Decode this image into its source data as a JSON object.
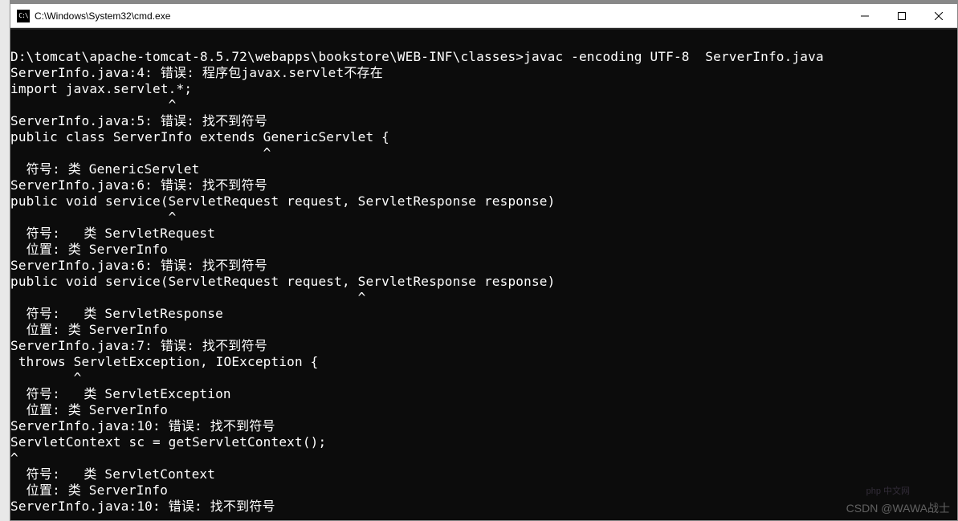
{
  "window": {
    "title": "C:\\Windows\\System32\\cmd.exe",
    "icon_label": "C:\\"
  },
  "terminal": {
    "prompt_path": "D:\\tomcat\\apache-tomcat-8.5.72\\webapps\\bookstore\\WEB-INF\\classes>",
    "command": "javac -encoding UTF-8  ServerInfo.java",
    "output_lines": [
      "",
      "D:\\tomcat\\apache-tomcat-8.5.72\\webapps\\bookstore\\WEB-INF\\classes>javac -encoding UTF-8  ServerInfo.java",
      "ServerInfo.java:4: 错误: 程序包javax.servlet不存在",
      "import javax.servlet.*;",
      "                    ^",
      "ServerInfo.java:5: 错误: 找不到符号",
      "public class ServerInfo extends GenericServlet {",
      "                                ^",
      "  符号: 类 GenericServlet",
      "ServerInfo.java:6: 错误: 找不到符号",
      "public void service(ServletRequest request, ServletResponse response)",
      "                    ^",
      "  符号:   类 ServletRequest",
      "  位置: 类 ServerInfo",
      "ServerInfo.java:6: 错误: 找不到符号",
      "public void service(ServletRequest request, ServletResponse response)",
      "                                            ^",
      "  符号:   类 ServletResponse",
      "  位置: 类 ServerInfo",
      "ServerInfo.java:7: 错误: 找不到符号",
      " throws ServletException, IOException {",
      "        ^",
      "  符号:   类 ServletException",
      "  位置: 类 ServerInfo",
      "ServerInfo.java:10: 错误: 找不到符号",
      "ServletContext sc = getServletContext();",
      "^",
      "  符号:   类 ServletContext",
      "  位置: 类 ServerInfo",
      "ServerInfo.java:10: 错误: 找不到符号"
    ]
  },
  "watermark": {
    "csdn": "CSDN @WAWA战士",
    "php": "php 中文网"
  }
}
